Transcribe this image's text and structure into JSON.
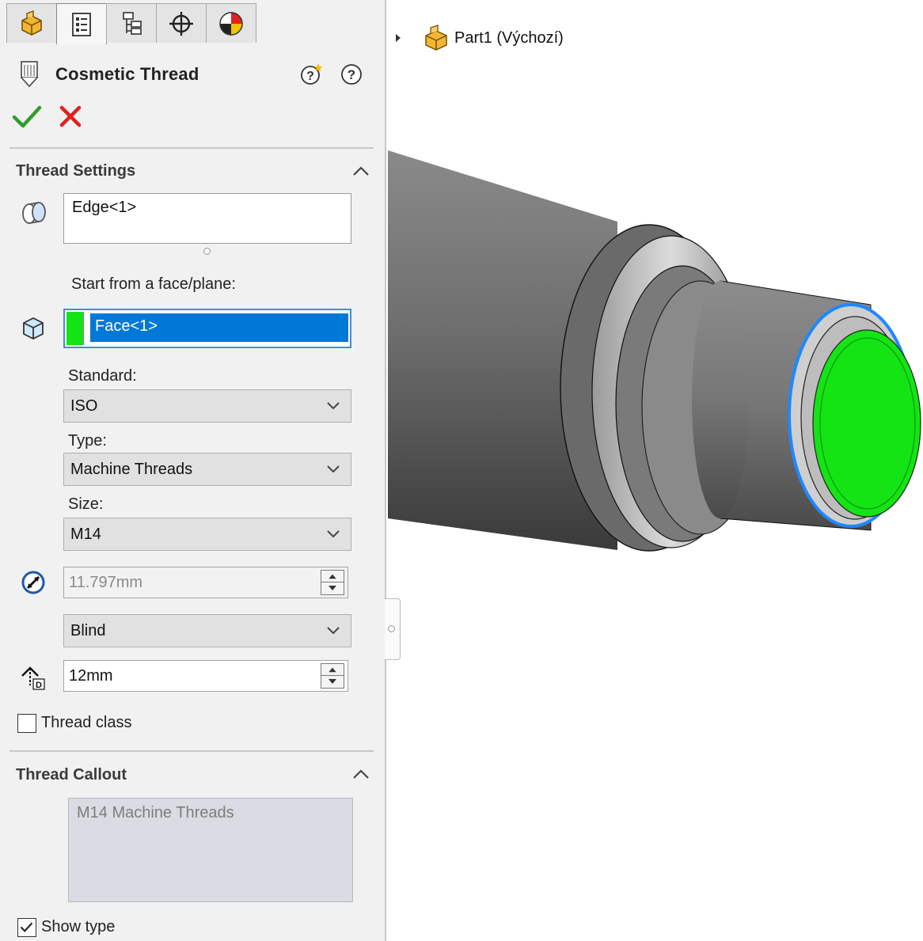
{
  "panel": {
    "tabs": [
      {
        "icon": "feature-manager-icon",
        "active": false
      },
      {
        "icon": "property-manager-icon",
        "active": true
      },
      {
        "icon": "configuration-manager-icon",
        "active": false
      },
      {
        "icon": "dimxpert-manager-icon",
        "active": false
      },
      {
        "icon": "display-manager-icon",
        "active": false
      }
    ],
    "title": "Cosmetic Thread",
    "thread_settings": {
      "heading": "Thread Settings",
      "edge_value": "Edge<1>",
      "start_label": "Start from a face/plane:",
      "face_value": "Face<1>",
      "standard_label": "Standard:",
      "standard_value": "ISO",
      "type_label": "Type:",
      "type_value": "Machine Threads",
      "size_label": "Size:",
      "size_value": "M14",
      "diameter_value": "11.797mm",
      "end_condition_value": "Blind",
      "depth_value": "12mm",
      "thread_class_label": "Thread class",
      "thread_class_checked": false
    },
    "thread_callout": {
      "heading": "Thread Callout",
      "callout_text": "M14 Machine Threads",
      "show_type_label": "Show type",
      "show_type_checked": true
    }
  },
  "tree": {
    "part_label": "Part1  (Výchozí)"
  },
  "colors": {
    "selection_green": "#14e314",
    "selection_blue": "#0078d7",
    "edge_highlight": "#1e88ff",
    "ok_green": "#2e9e2e",
    "cancel_red": "#e02020"
  }
}
